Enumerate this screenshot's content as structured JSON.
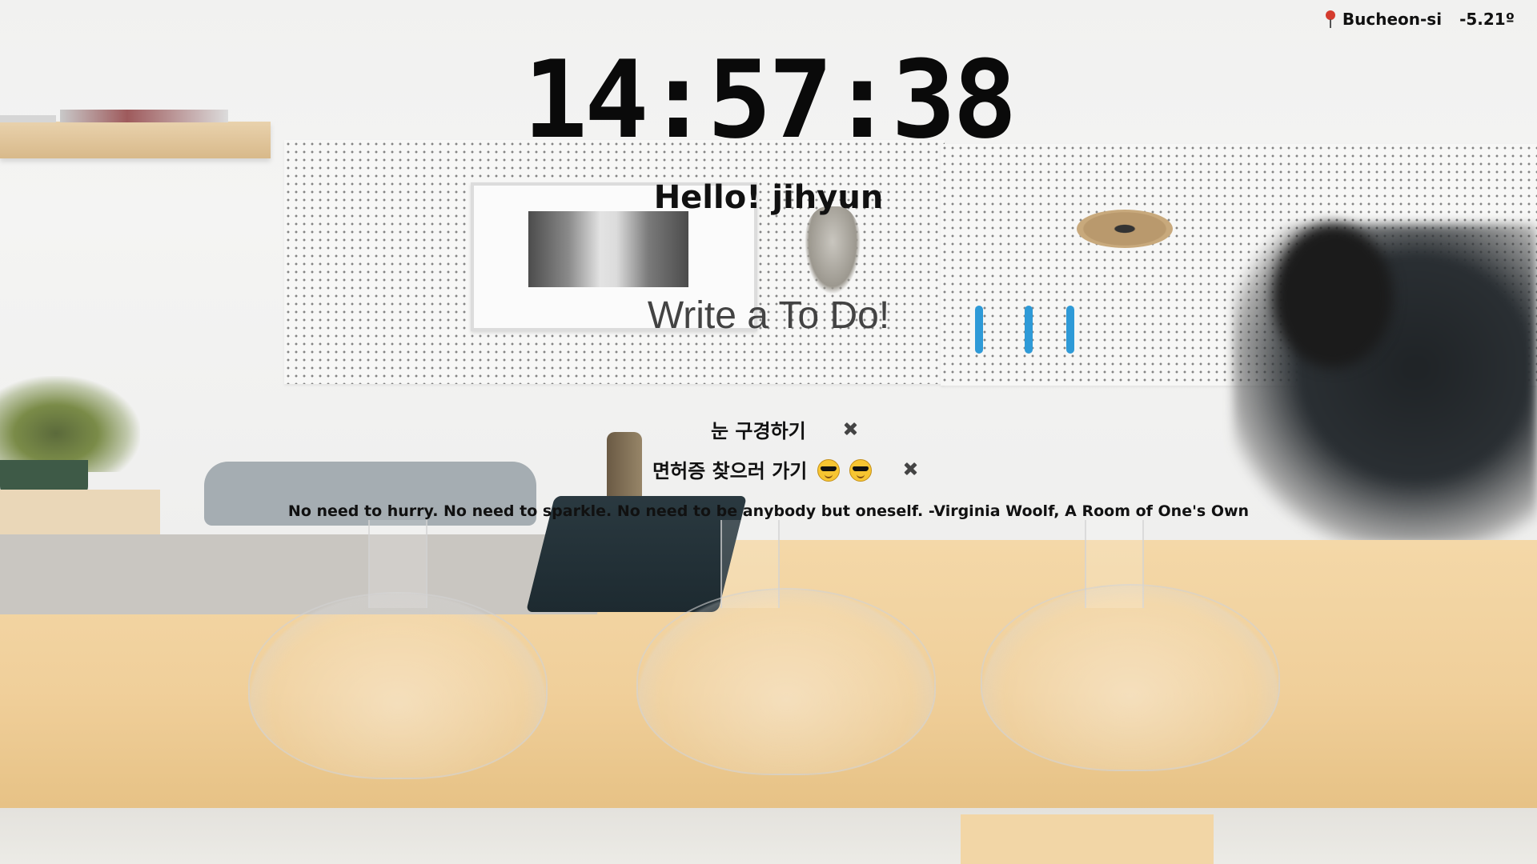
{
  "weather": {
    "city": "Bucheon-si",
    "temperature": "-5.21º",
    "location_icon": "location-pin-icon"
  },
  "clock": {
    "time": "14:57:38"
  },
  "greeting": {
    "text": "Hello! jihyun"
  },
  "todo": {
    "placeholder": "Write a To Do!",
    "value": "",
    "items": [
      {
        "text": "눈 구경하기",
        "emojis": []
      },
      {
        "text": "면허증 찾으러 가기",
        "emojis": [
          "sunglasses-emoji-icon",
          "sunglasses-emoji-icon"
        ]
      }
    ],
    "delete_icon": "x-icon"
  },
  "quote": {
    "text": "No need to hurry. No need to sparkle. No need to be anybody but oneself.",
    "author": "-Virginia Woolf, A Room of One's Own"
  },
  "colors": {
    "text": "#111111",
    "pin": "#d43b2e",
    "table_wood": "#f0cf9a",
    "wall": "#f1f1f0"
  }
}
